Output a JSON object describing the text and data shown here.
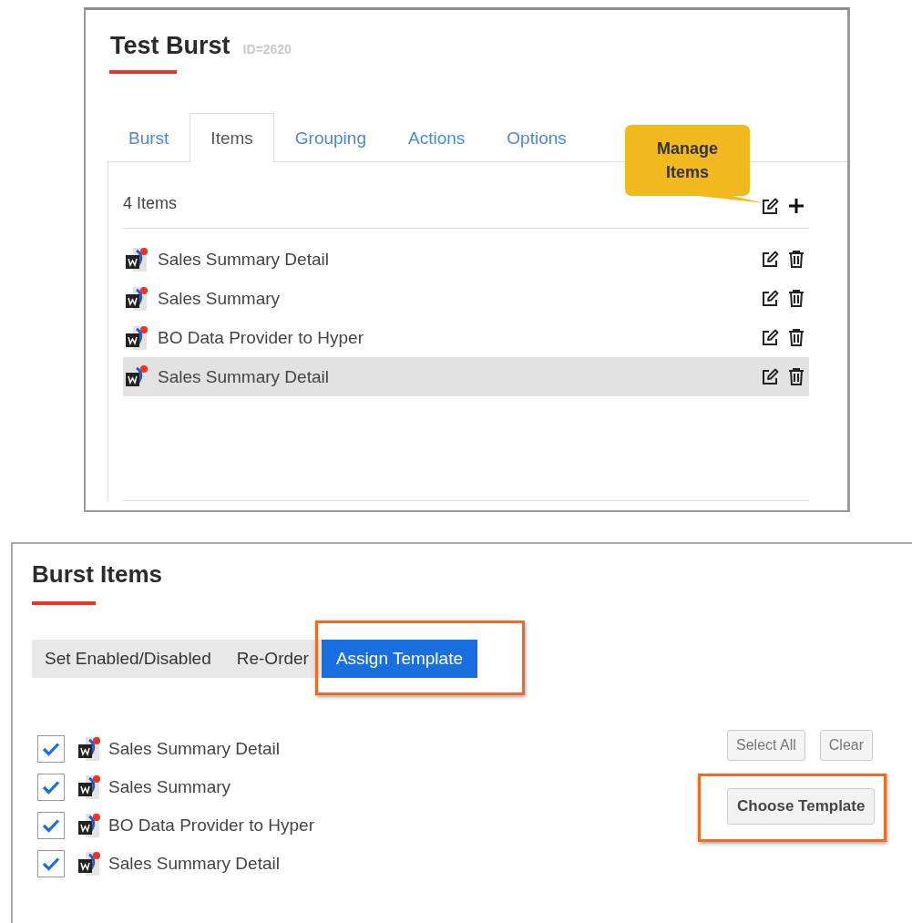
{
  "header": {
    "title": "Test Burst",
    "id_label": "ID=2620"
  },
  "tabs": [
    {
      "label": "Burst",
      "selected": false
    },
    {
      "label": "Items",
      "selected": true
    },
    {
      "label": "Grouping",
      "selected": false
    },
    {
      "label": "Actions",
      "selected": false
    },
    {
      "label": "Options",
      "selected": false
    }
  ],
  "callout": {
    "text": "Manage Items"
  },
  "items_panel": {
    "count": "4 Items",
    "items": [
      {
        "name": "Sales Summary Detail",
        "highlighted": false
      },
      {
        "name": "Sales Summary",
        "highlighted": false
      },
      {
        "name": "BO Data Provider to Hyper",
        "highlighted": false
      },
      {
        "name": "Sales Summary Detail",
        "highlighted": true
      }
    ]
  },
  "burst_items": {
    "title": "Burst Items",
    "modes": [
      {
        "label": "Set Enabled/Disabled",
        "selected": false,
        "annotated": false
      },
      {
        "label": "Re-Order",
        "selected": false,
        "annotated": false
      },
      {
        "label": "Assign Template",
        "selected": true,
        "annotated": true
      }
    ],
    "items": [
      {
        "name": "Sales Summary Detail",
        "checked": true
      },
      {
        "name": "Sales Summary",
        "checked": true
      },
      {
        "name": "BO Data Provider to Hyper",
        "checked": true
      },
      {
        "name": "Sales Summary Detail",
        "checked": true
      }
    ],
    "buttons": [
      {
        "label": "Select All",
        "kind": "small",
        "annotated": false
      },
      {
        "label": "Clear",
        "kind": "small",
        "annotated": false
      },
      {
        "label": "Choose Template",
        "kind": "large",
        "annotated": true
      }
    ]
  }
}
